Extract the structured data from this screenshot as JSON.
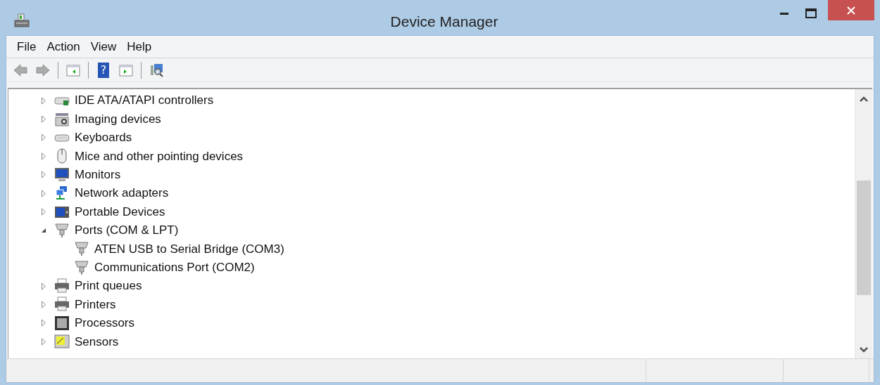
{
  "window": {
    "title": "Device Manager"
  },
  "menu": [
    "File",
    "Action",
    "View",
    "Help"
  ],
  "toolbar": [
    {
      "kind": "back",
      "disabled": true
    },
    {
      "kind": "forward",
      "disabled": true
    },
    {
      "kind": "separator"
    },
    {
      "kind": "panel-left"
    },
    {
      "kind": "separator"
    },
    {
      "kind": "help",
      "label": "?"
    },
    {
      "kind": "panel-right"
    },
    {
      "kind": "separator"
    },
    {
      "kind": "scan"
    }
  ],
  "tree": [
    {
      "label": "IDE ATA/ATAPI controllers",
      "kind": "drive",
      "expanded": false
    },
    {
      "label": "Imaging devices",
      "kind": "camera",
      "expanded": false
    },
    {
      "label": "Keyboards",
      "kind": "keyboard",
      "expanded": false
    },
    {
      "label": "Mice and other pointing devices",
      "kind": "mouse",
      "expanded": false
    },
    {
      "label": "Monitors",
      "kind": "monitor",
      "expanded": false
    },
    {
      "label": "Network adapters",
      "kind": "network",
      "expanded": false
    },
    {
      "label": "Portable Devices",
      "kind": "portable",
      "expanded": false
    },
    {
      "label": "Ports (COM & LPT)",
      "kind": "port",
      "expanded": true,
      "children": [
        {
          "label": "ATEN USB to Serial Bridge (COM3)",
          "kind": "port"
        },
        {
          "label": "Communications Port (COM2)",
          "kind": "port"
        }
      ]
    },
    {
      "label": "Print queues",
      "kind": "printer",
      "expanded": false
    },
    {
      "label": "Printers",
      "kind": "printer",
      "expanded": false
    },
    {
      "label": "Processors",
      "kind": "chip",
      "expanded": false
    },
    {
      "label": "Sensors",
      "kind": "sensor",
      "expanded": false
    }
  ]
}
